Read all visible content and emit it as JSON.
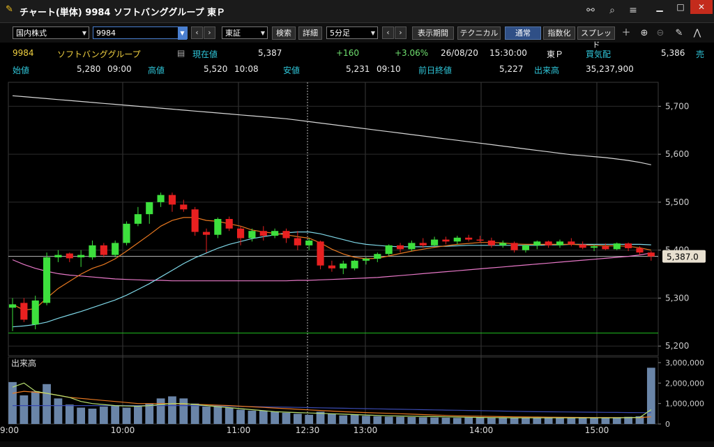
{
  "window": {
    "title": "チャート(単体) 9984 ソフトバンググループ 東Ｐ",
    "controls": {
      "minimize": "▁",
      "maximize": "□",
      "close": "✕"
    }
  },
  "toolbar": {
    "market_select": "国内株式",
    "code_input": "9984",
    "exchange_select": "東証",
    "search_label": "検索",
    "detail_label": "詳細",
    "interval_select": "5分足",
    "period_label": "表示期間",
    "technical_label": "テクニカル",
    "normal_label": "通常",
    "index_label": "指数化",
    "spread_label": "スプレッド"
  },
  "quote": {
    "code": "9984",
    "name": "ソフトバンググループ",
    "current_label": "現在値",
    "current": "5,387",
    "change": "+160",
    "change_pct": "+3.06%",
    "date": "26/08/20",
    "time": "15:30:00",
    "market": "東Ｐ",
    "bid_label": "買気配",
    "bid": "5,386",
    "ask_label": "売",
    "open_label": "始値",
    "open": "5,280",
    "open_time": "09:00",
    "high_label": "高値",
    "high": "5,520",
    "high_time": "10:08",
    "low_label": "安値",
    "low": "5,231",
    "low_time": "09:10",
    "prev_label": "前日終値",
    "prev": "5,227",
    "volume_label": "出来高",
    "volume": "35,237,900"
  },
  "colors": {
    "up": "#3de03d",
    "down": "#e82020",
    "ma_short": "#e87820",
    "ma_mid": "#7fd8e8",
    "ma_long": "#e878c8",
    "ma_200": "#d8d8d8",
    "prev_close_line": "#20c020",
    "volume_bar": "#6a85a8"
  },
  "chart_data": {
    "type": "candlestick",
    "price_axis": {
      "min": 5200,
      "max": 5700,
      "ticks": [
        "5,700",
        "5,600",
        "5,500",
        "5,400",
        "5,300",
        "5,200"
      ],
      "tick_values": [
        5700,
        5600,
        5500,
        5400,
        5300,
        5200
      ]
    },
    "current_price_label": "5,387.0",
    "current_price": 5387,
    "prev_close": 5227,
    "time_labels": [
      "9:00",
      "10:00",
      "11:00",
      "12:30",
      "13:00",
      "14:00",
      "15:00"
    ],
    "volume_panel_label": "出来高",
    "volume_axis": {
      "ticks": [
        "3,000,000",
        "2,000,000",
        "1,000,000",
        "0"
      ],
      "tick_values": [
        3000000,
        2000000,
        1000000,
        0
      ]
    },
    "candles": [
      {
        "o": 5280,
        "h": 5300,
        "l": 5231,
        "c": 5287
      },
      {
        "o": 5290,
        "h": 5300,
        "l": 5250,
        "c": 5255
      },
      {
        "o": 5245,
        "h": 5305,
        "l": 5235,
        "c": 5295
      },
      {
        "o": 5290,
        "h": 5395,
        "l": 5285,
        "c": 5385
      },
      {
        "o": 5385,
        "h": 5400,
        "l": 5375,
        "c": 5390
      },
      {
        "o": 5393,
        "h": 5395,
        "l": 5375,
        "c": 5383
      },
      {
        "o": 5385,
        "h": 5400,
        "l": 5365,
        "c": 5390
      },
      {
        "o": 5385,
        "h": 5420,
        "l": 5380,
        "c": 5410
      },
      {
        "o": 5410,
        "h": 5415,
        "l": 5385,
        "c": 5390
      },
      {
        "o": 5390,
        "h": 5420,
        "l": 5385,
        "c": 5415
      },
      {
        "o": 5415,
        "h": 5460,
        "l": 5410,
        "c": 5455
      },
      {
        "o": 5455,
        "h": 5490,
        "l": 5450,
        "c": 5475
      },
      {
        "o": 5475,
        "h": 5500,
        "l": 5455,
        "c": 5500
      },
      {
        "o": 5500,
        "h": 5520,
        "l": 5490,
        "c": 5515
      },
      {
        "o": 5515,
        "h": 5520,
        "l": 5480,
        "c": 5495
      },
      {
        "o": 5495,
        "h": 5505,
        "l": 5480,
        "c": 5485
      },
      {
        "o": 5485,
        "h": 5490,
        "l": 5430,
        "c": 5438
      },
      {
        "o": 5438,
        "h": 5445,
        "l": 5395,
        "c": 5432
      },
      {
        "o": 5432,
        "h": 5468,
        "l": 5425,
        "c": 5465
      },
      {
        "o": 5465,
        "h": 5470,
        "l": 5440,
        "c": 5445
      },
      {
        "o": 5445,
        "h": 5450,
        "l": 5410,
        "c": 5425
      },
      {
        "o": 5425,
        "h": 5445,
        "l": 5418,
        "c": 5440
      },
      {
        "o": 5440,
        "h": 5450,
        "l": 5420,
        "c": 5430
      },
      {
        "o": 5430,
        "h": 5445,
        "l": 5425,
        "c": 5440
      },
      {
        "o": 5440,
        "h": 5445,
        "l": 5415,
        "c": 5425
      },
      {
        "o": 5425,
        "h": 5440,
        "l": 5400,
        "c": 5410
      },
      {
        "o": 5410,
        "h": 5425,
        "l": 5400,
        "c": 5420
      },
      {
        "o": 5418,
        "h": 5420,
        "l": 5360,
        "c": 5368
      },
      {
        "o": 5368,
        "h": 5378,
        "l": 5355,
        "c": 5362
      },
      {
        "o": 5362,
        "h": 5378,
        "l": 5350,
        "c": 5372
      },
      {
        "o": 5362,
        "h": 5380,
        "l": 5358,
        "c": 5378
      },
      {
        "o": 5378,
        "h": 5385,
        "l": 5370,
        "c": 5382
      },
      {
        "o": 5382,
        "h": 5395,
        "l": 5375,
        "c": 5392
      },
      {
        "o": 5392,
        "h": 5412,
        "l": 5388,
        "c": 5410
      },
      {
        "o": 5410,
        "h": 5415,
        "l": 5395,
        "c": 5402
      },
      {
        "o": 5402,
        "h": 5420,
        "l": 5398,
        "c": 5415
      },
      {
        "o": 5415,
        "h": 5425,
        "l": 5405,
        "c": 5410
      },
      {
        "o": 5410,
        "h": 5428,
        "l": 5408,
        "c": 5422
      },
      {
        "o": 5422,
        "h": 5428,
        "l": 5412,
        "c": 5418
      },
      {
        "o": 5418,
        "h": 5430,
        "l": 5412,
        "c": 5426
      },
      {
        "o": 5426,
        "h": 5432,
        "l": 5418,
        "c": 5422
      },
      {
        "o": 5422,
        "h": 5430,
        "l": 5415,
        "c": 5420
      },
      {
        "o": 5420,
        "h": 5426,
        "l": 5405,
        "c": 5410
      },
      {
        "o": 5410,
        "h": 5420,
        "l": 5405,
        "c": 5415
      },
      {
        "o": 5415,
        "h": 5418,
        "l": 5395,
        "c": 5400
      },
      {
        "o": 5400,
        "h": 5412,
        "l": 5395,
        "c": 5410
      },
      {
        "o": 5410,
        "h": 5420,
        "l": 5402,
        "c": 5418
      },
      {
        "o": 5418,
        "h": 5420,
        "l": 5405,
        "c": 5410
      },
      {
        "o": 5410,
        "h": 5422,
        "l": 5405,
        "c": 5418
      },
      {
        "o": 5418,
        "h": 5425,
        "l": 5408,
        "c": 5412
      },
      {
        "o": 5412,
        "h": 5418,
        "l": 5402,
        "c": 5405
      },
      {
        "o": 5405,
        "h": 5412,
        "l": 5398,
        "c": 5408
      },
      {
        "o": 5408,
        "h": 5414,
        "l": 5400,
        "c": 5402
      },
      {
        "o": 5402,
        "h": 5416,
        "l": 5400,
        "c": 5414
      },
      {
        "o": 5414,
        "h": 5416,
        "l": 5398,
        "c": 5404
      },
      {
        "o": 5404,
        "h": 5408,
        "l": 5390,
        "c": 5395
      },
      {
        "o": 5395,
        "h": 5398,
        "l": 5378,
        "c": 5387
      }
    ],
    "ma_short": [
      5287,
      5275,
      5278,
      5300,
      5320,
      5335,
      5350,
      5362,
      5370,
      5382,
      5398,
      5415,
      5432,
      5450,
      5462,
      5468,
      5468,
      5462,
      5460,
      5455,
      5450,
      5442,
      5438,
      5435,
      5432,
      5428,
      5425,
      5415,
      5402,
      5392,
      5385,
      5382,
      5383,
      5388,
      5393,
      5398,
      5402,
      5406,
      5409,
      5412,
      5414,
      5416,
      5416,
      5415,
      5413,
      5412,
      5412,
      5412,
      5412,
      5412,
      5411,
      5410,
      5409,
      5409,
      5408,
      5405,
      5400
    ],
    "ma_mid": [
      5240,
      5242,
      5245,
      5250,
      5258,
      5265,
      5272,
      5280,
      5288,
      5296,
      5306,
      5318,
      5330,
      5344,
      5358,
      5372,
      5384,
      5394,
      5404,
      5412,
      5418,
      5424,
      5428,
      5432,
      5436,
      5438,
      5438,
      5434,
      5428,
      5422,
      5416,
      5412,
      5410,
      5408,
      5407,
      5407,
      5407,
      5408,
      5408,
      5409,
      5410,
      5410,
      5410,
      5410,
      5410,
      5410,
      5410,
      5411,
      5411,
      5412,
      5412,
      5412,
      5412,
      5412,
      5412,
      5412,
      5411
    ],
    "ma_long": [
      5380,
      5370,
      5362,
      5356,
      5351,
      5348,
      5346,
      5344,
      5342,
      5340,
      5339,
      5338,
      5337,
      5337,
      5336,
      5336,
      5336,
      5336,
      5336,
      5336,
      5336,
      5336,
      5336,
      5336,
      5336,
      5337,
      5337,
      5338,
      5339,
      5340,
      5341,
      5342,
      5343,
      5345,
      5347,
      5349,
      5351,
      5353,
      5355,
      5357,
      5359,
      5361,
      5363,
      5365,
      5367,
      5369,
      5371,
      5373,
      5375,
      5377,
      5379,
      5381,
      5383,
      5385,
      5387,
      5390,
      5394
    ],
    "ma_200": [
      5722,
      5720,
      5718,
      5716,
      5714,
      5712,
      5710,
      5708,
      5706,
      5704,
      5702,
      5700,
      5698,
      5696,
      5694,
      5692,
      5690,
      5688,
      5686,
      5684,
      5682,
      5680,
      5678,
      5676,
      5674,
      5671,
      5668,
      5665,
      5662,
      5659,
      5656,
      5653,
      5650,
      5647,
      5644,
      5641,
      5638,
      5635,
      5632,
      5629,
      5626,
      5623,
      5620,
      5617,
      5614,
      5611,
      5608,
      5605,
      5602,
      5599,
      5597,
      5595,
      5593,
      5590,
      5587,
      5583,
      5578
    ],
    "volume": [
      2050000,
      1400000,
      1600000,
      1950000,
      1250000,
      950000,
      800000,
      750000,
      850000,
      900000,
      800000,
      850000,
      1000000,
      1250000,
      1350000,
      1250000,
      1000000,
      850000,
      900000,
      800000,
      700000,
      650000,
      650000,
      600000,
      550000,
      500000,
      450000,
      600000,
      500000,
      420000,
      450000,
      400000,
      380000,
      360000,
      350000,
      340000,
      330000,
      320000,
      310000,
      300000,
      320000,
      310000,
      300000,
      290000,
      300000,
      310000,
      300000,
      320000,
      300000,
      300000,
      310000,
      300000,
      320000,
      330000,
      350000,
      380000,
      2750000
    ],
    "vol_ma_short": [
      1800000,
      2000000,
      1600000,
      1500000,
      1400000,
      1300000,
      1100000,
      1000000,
      950000,
      900000,
      880000,
      870000,
      900000,
      950000,
      1000000,
      1000000,
      950000,
      900000,
      850000,
      800000,
      750000,
      700000,
      650000,
      600000,
      580000,
      560000,
      540000,
      520000,
      500000,
      480000,
      460000,
      440000,
      420000,
      400000,
      390000,
      380000,
      370000,
      360000,
      350000,
      340000,
      330000,
      320000,
      315000,
      310000,
      305000,
      300000,
      300000,
      300000,
      300000,
      300000,
      300000,
      300000,
      300000,
      300000,
      310000,
      320000,
      700000
    ],
    "vol_ma_mid": [
      1500000,
      1600000,
      1550000,
      1500000,
      1400000,
      1300000,
      1250000,
      1200000,
      1150000,
      1100000,
      1050000,
      1000000,
      1000000,
      1000000,
      990000,
      980000,
      960000,
      940000,
      920000,
      900000,
      870000,
      840000,
      810000,
      780000,
      750000,
      720000,
      690000,
      660000,
      630000,
      600000,
      580000,
      560000,
      540000,
      520000,
      500000,
      480000,
      460000,
      440000,
      420000,
      400000,
      390000,
      380000,
      370000,
      360000,
      350000,
      345000,
      340000,
      335000,
      330000,
      325000,
      320000,
      318000,
      316000,
      314000,
      312000,
      310000,
      350000
    ],
    "vol_ma_long": [
      900000,
      900000,
      900000,
      900000,
      900000,
      900000,
      900000,
      900000,
      900000,
      900000,
      900000,
      900000,
      900000,
      900000,
      900000,
      900000,
      900000,
      890000,
      880000,
      870000,
      860000,
      850000,
      840000,
      830000,
      820000,
      810000,
      800000,
      790000,
      780000,
      770000,
      760000,
      750000,
      740000,
      730000,
      720000,
      710000,
      700000,
      690000,
      680000,
      670000,
      660000,
      650000,
      640000,
      630000,
      620000,
      610000,
      600000,
      595000,
      590000,
      585000,
      580000,
      575000,
      570000,
      565000,
      560000,
      555000,
      550000
    ]
  }
}
